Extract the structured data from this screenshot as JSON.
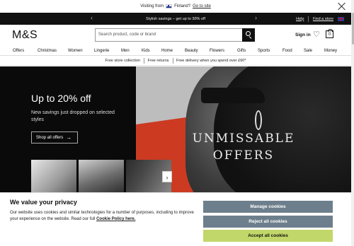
{
  "country_bar": {
    "visiting_label": "Visiting from",
    "country": "Finland?",
    "link": "Go to site"
  },
  "promo_strip": {
    "text": "Stylish savings – get up to 30% off",
    "help": "Help",
    "find_store": "Find a store"
  },
  "header": {
    "logo": "M&S",
    "search_placeholder": "Search product, code or brand",
    "sign_in": "Sign in",
    "bag_count": "0"
  },
  "nav": {
    "items": [
      "Offers",
      "Christmas",
      "Women",
      "Lingerie",
      "Men",
      "Kids",
      "Home",
      "Beauty",
      "Flowers",
      "Gifts",
      "Sports",
      "Food",
      "Sale",
      "Money"
    ]
  },
  "delivery": {
    "items": [
      "Free store collection",
      "Free returns",
      "Free delivery when you spend over £60*"
    ]
  },
  "hero": {
    "headline": "Up to 20% off",
    "subtext": "New savings just dropped on selected styles",
    "cta": "Shop all offers",
    "overlay_line1": "UNMISSABLE",
    "overlay_line2": "OFFERS"
  },
  "cookie": {
    "title": "We value your privacy",
    "body": "Our website uses cookies and similar technologies for a number of purposes, including to improve your experience on the website. Read our full",
    "policy_link": "Cookie Policy here.",
    "manage": "Manage cookies",
    "reject": "Reject all cookies",
    "accept": "Accept all cookies"
  },
  "colors": {
    "cookie_button": "#6d7f8c",
    "accept_button": "#c2d76a",
    "promo_bg": "#111111",
    "hero_red": "#cc3a22"
  }
}
